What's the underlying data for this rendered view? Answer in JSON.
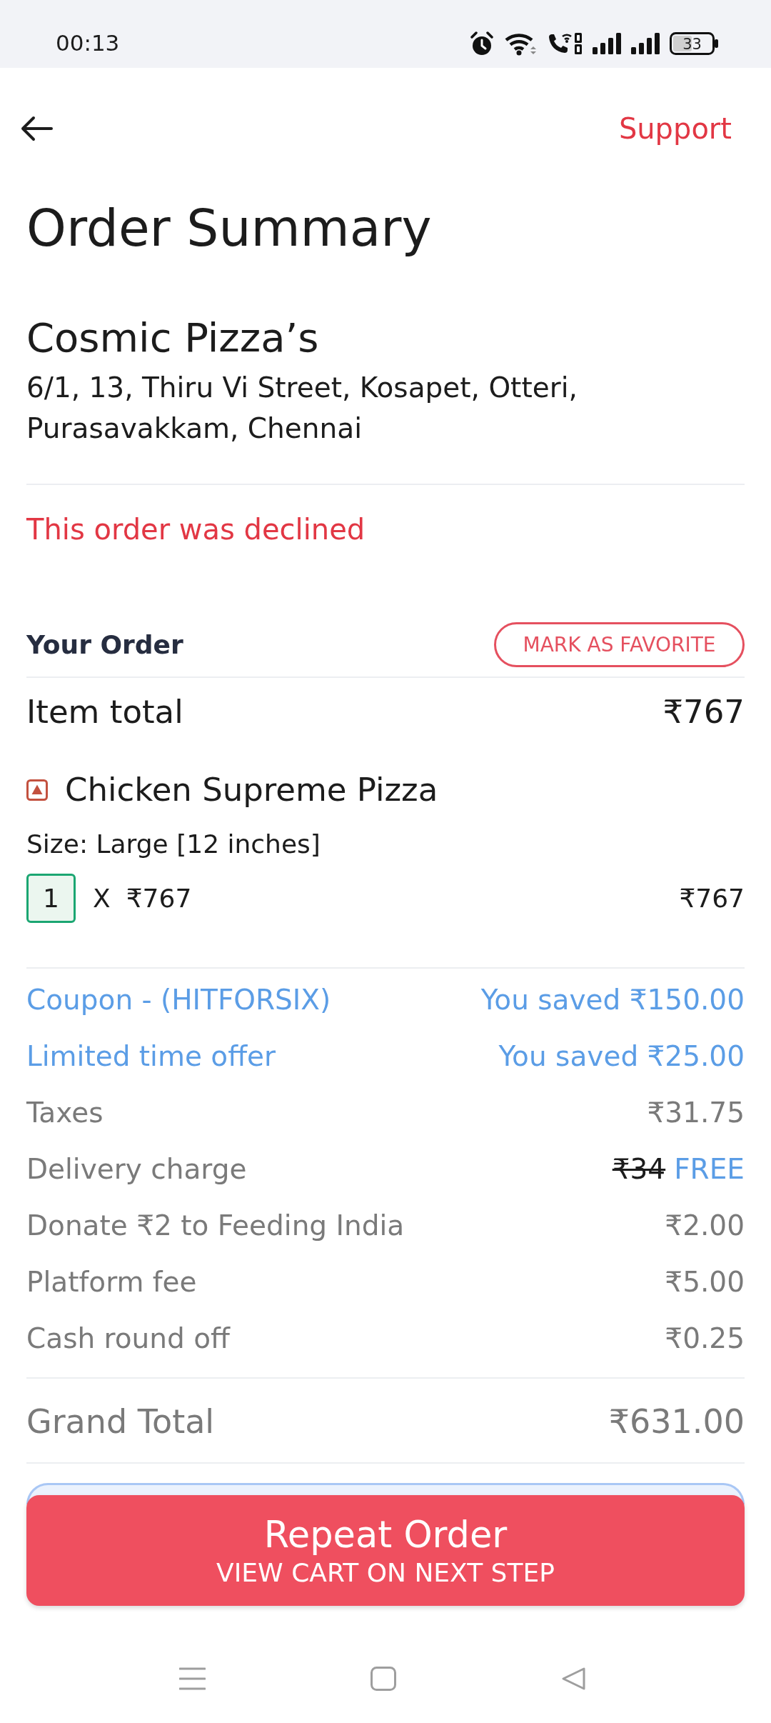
{
  "status_bar": {
    "time": "00:13",
    "battery": "33"
  },
  "header": {
    "action": "Support"
  },
  "title": "Order Summary",
  "restaurant": {
    "name": "Cosmic Pizza’s",
    "address": "6/1, 13, Thiru Vi Street, Kosapet, Otteri, Purasavakkam, Chennai"
  },
  "order_status": "This order was declined",
  "your_order": {
    "heading": "Your Order",
    "favorite_button": "MARK AS FAVORITE",
    "item_total": {
      "label": "Item total",
      "value": "₹767"
    },
    "items": [
      {
        "name": "Chicken Supreme Pizza",
        "details": "Size: Large [12 inches]",
        "quantity": "1",
        "multiplier": "X",
        "unit_price": "₹767",
        "price": "₹767"
      }
    ]
  },
  "bill": {
    "rows": [
      {
        "kind": "saving",
        "label": "Coupon - (HITFORSIX)",
        "value": "You saved ₹150.00"
      },
      {
        "kind": "saving",
        "label": "Limited time offer",
        "value": "You saved ₹25.00"
      },
      {
        "kind": "charge",
        "label": "Taxes",
        "value": "₹31.75"
      },
      {
        "kind": "waived",
        "label": "Delivery charge",
        "original": "₹34",
        "value": "FREE"
      },
      {
        "kind": "charge",
        "label": "Donate ₹2 to Feeding India",
        "value": "₹2.00"
      },
      {
        "kind": "charge",
        "label": "Platform fee",
        "value": "₹5.00"
      },
      {
        "kind": "charge",
        "label": "Cash round off",
        "value": "₹0.25"
      }
    ],
    "grand_total": {
      "label": "Grand Total",
      "value": "₹631.00"
    }
  },
  "action_button": {
    "label": "Repeat Order",
    "sublabel": "VIEW CART ON NEXT STEP"
  }
}
